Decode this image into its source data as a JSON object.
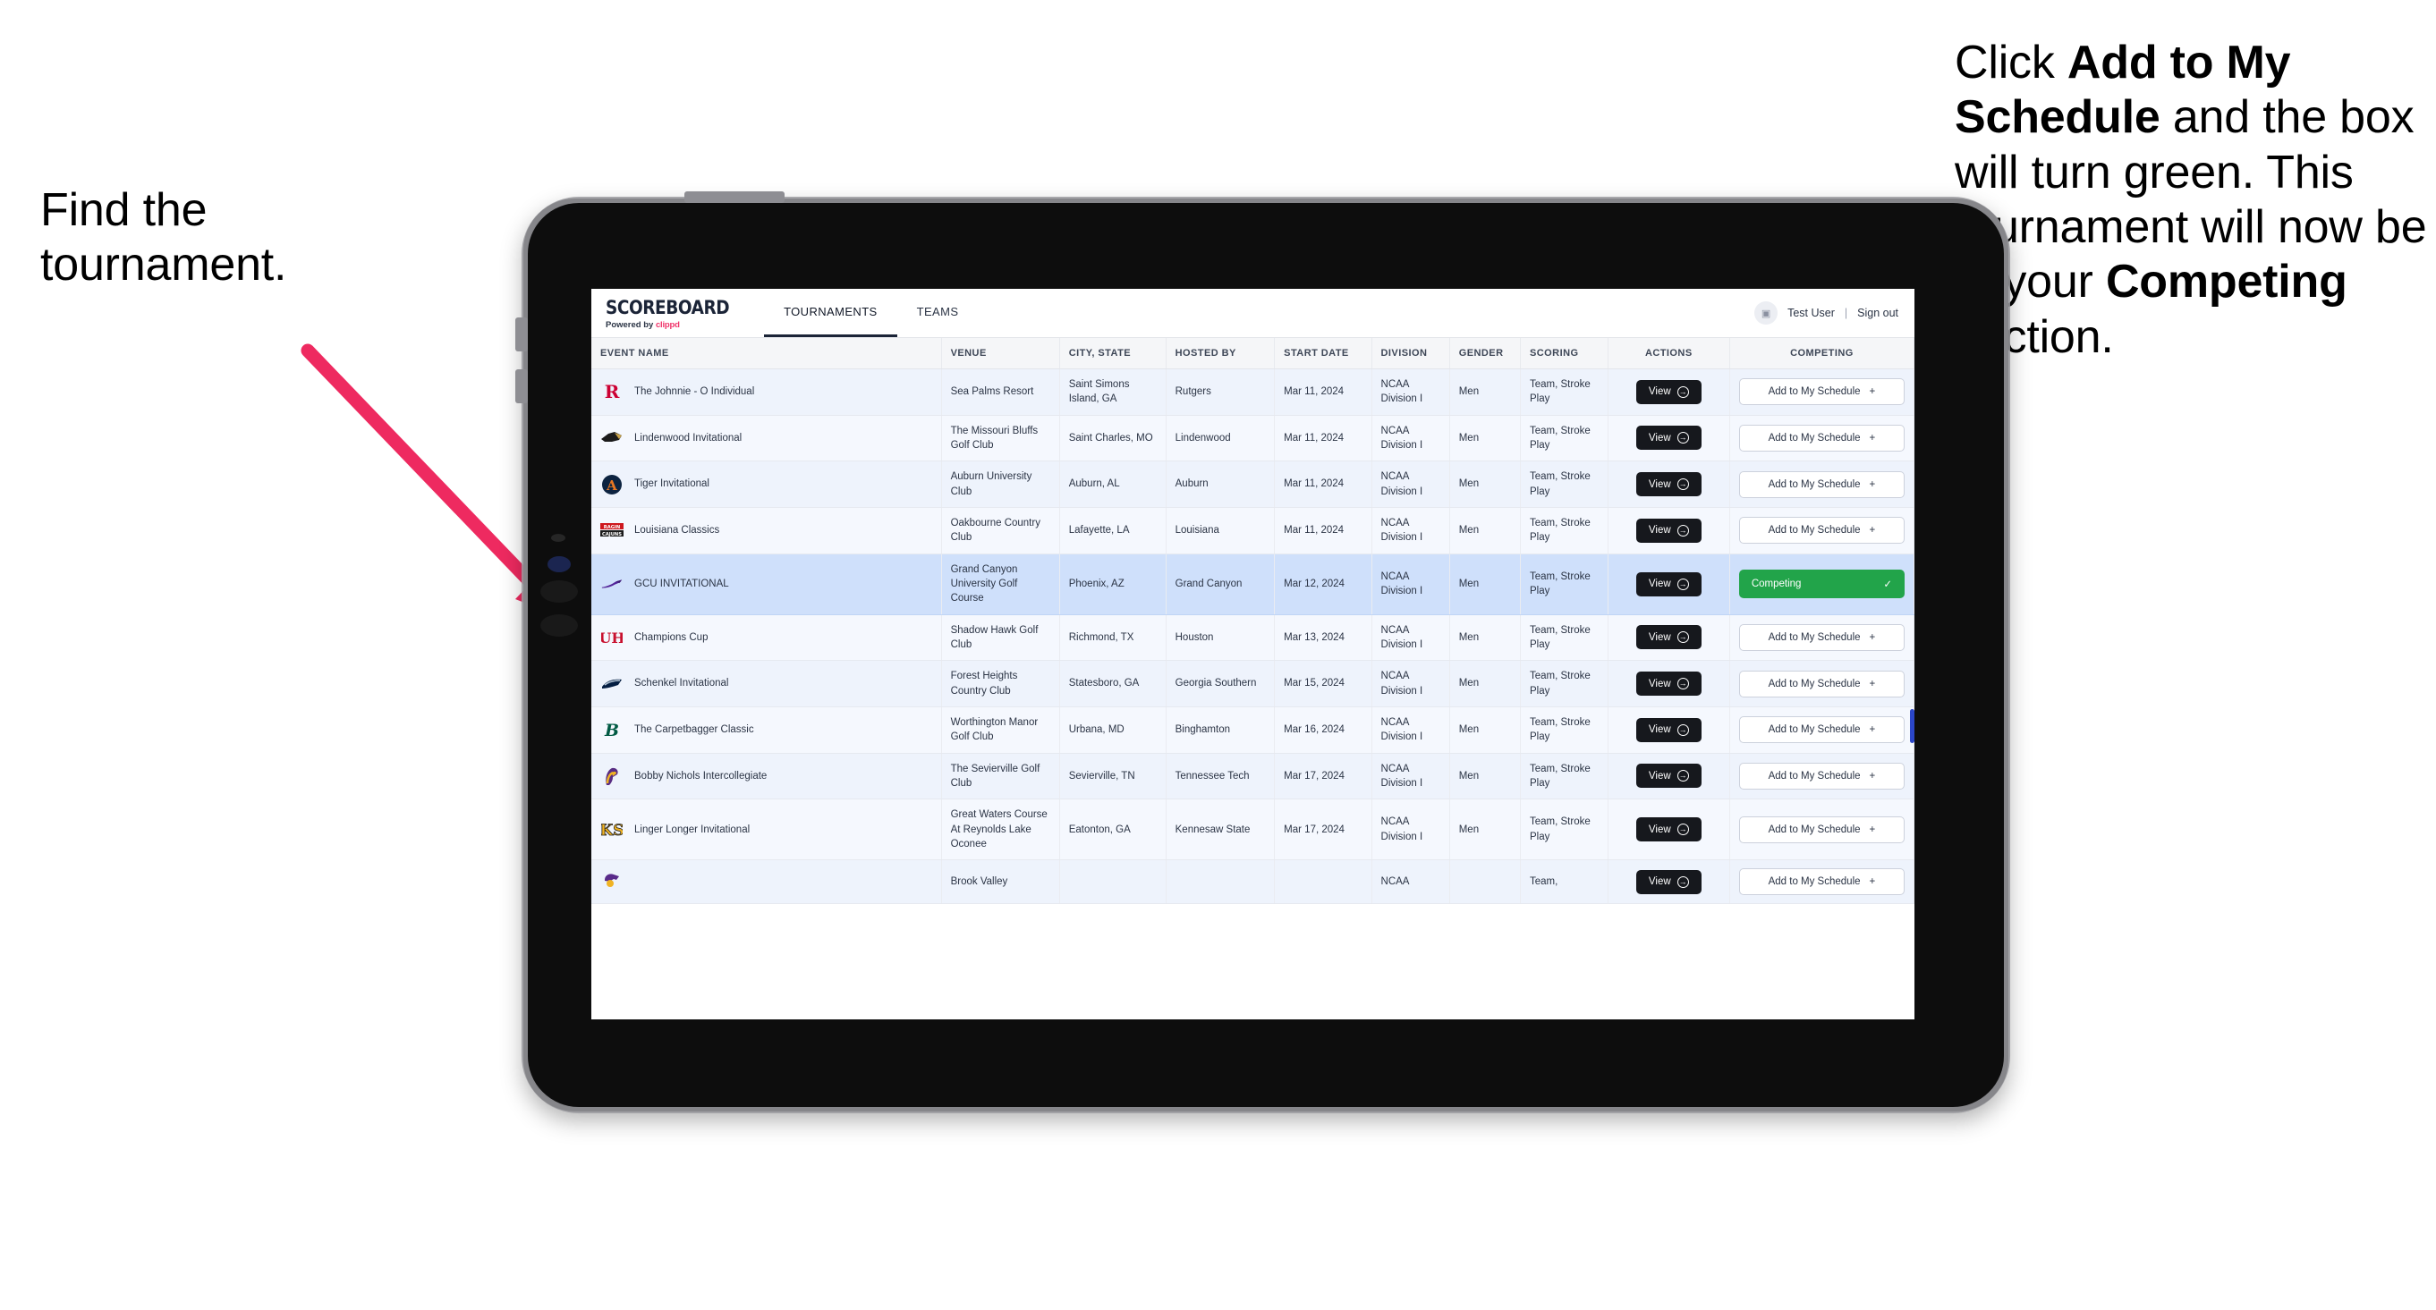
{
  "annotations": {
    "left": {
      "line1": "Find the",
      "line2": "tournament."
    },
    "right": {
      "seg1": "Click ",
      "bold1": "Add to My Schedule",
      "seg2": " and the box will turn green. This tournament will now be in your ",
      "bold2": "Competing",
      "seg3": " section."
    },
    "arrow_color": "#ee2a60"
  },
  "app": {
    "brand": {
      "title": "SCOREBOARD",
      "powered_prefix": "Powered by ",
      "powered_brand": "clippd"
    },
    "tabs": [
      {
        "label": "TOURNAMENTS",
        "active": true
      },
      {
        "label": "TEAMS",
        "active": false
      }
    ],
    "account": {
      "avatar_icon": "user-avatar-icon",
      "user": "Test User",
      "separator": "|",
      "signout": "Sign out"
    },
    "table": {
      "columns": [
        "EVENT NAME",
        "VENUE",
        "CITY, STATE",
        "HOSTED BY",
        "START DATE",
        "DIVISION",
        "GENDER",
        "SCORING",
        "ACTIONS",
        "COMPETING"
      ],
      "view_label": "View",
      "add_label": "Add to My Schedule",
      "add_icon": "plus-icon",
      "competing_label": "Competing",
      "competing_icon": "check-icon",
      "competing_color": "#22a44a",
      "rows": [
        {
          "logo": "rutgers-r-logo",
          "event": "The Johnnie - O Individual",
          "venue": "Sea Palms Resort",
          "city": "Saint Simons Island, GA",
          "hosted_by": "Rutgers",
          "start_date": "Mar 11, 2024",
          "division": "NCAA Division I",
          "gender": "Men",
          "scoring": "Team, Stroke Play",
          "competing": false
        },
        {
          "logo": "lindenwood-lion-logo",
          "event": "Lindenwood Invitational",
          "venue": "The Missouri Bluffs Golf Club",
          "city": "Saint Charles, MO",
          "hosted_by": "Lindenwood",
          "start_date": "Mar 11, 2024",
          "division": "NCAA Division I",
          "gender": "Men",
          "scoring": "Team, Stroke Play",
          "competing": false
        },
        {
          "logo": "auburn-au-logo",
          "event": "Tiger Invitational",
          "venue": "Auburn University Club",
          "city": "Auburn, AL",
          "hosted_by": "Auburn",
          "start_date": "Mar 11, 2024",
          "division": "NCAA Division I",
          "gender": "Men",
          "scoring": "Team, Stroke Play",
          "competing": false
        },
        {
          "logo": "louisiana-ragin-cajuns-logo",
          "event": "Louisiana Classics",
          "venue": "Oakbourne Country Club",
          "city": "Lafayette, LA",
          "hosted_by": "Louisiana",
          "start_date": "Mar 11, 2024",
          "division": "NCAA Division I",
          "gender": "Men",
          "scoring": "Team, Stroke Play",
          "competing": false
        },
        {
          "logo": "gcu-lope-logo",
          "event": "GCU INVITATIONAL",
          "venue": "Grand Canyon University Golf Course",
          "city": "Phoenix, AZ",
          "hosted_by": "Grand Canyon",
          "start_date": "Mar 12, 2024",
          "division": "NCAA Division I",
          "gender": "Men",
          "scoring": "Team, Stroke Play",
          "competing": true
        },
        {
          "logo": "houston-uh-logo",
          "event": "Champions Cup",
          "venue": "Shadow Hawk Golf Club",
          "city": "Richmond, TX",
          "hosted_by": "Houston",
          "start_date": "Mar 13, 2024",
          "division": "NCAA Division I",
          "gender": "Men",
          "scoring": "Team, Stroke Play",
          "competing": false
        },
        {
          "logo": "georgia-southern-eagle-logo",
          "event": "Schenkel Invitational",
          "venue": "Forest Heights Country Club",
          "city": "Statesboro, GA",
          "hosted_by": "Georgia Southern",
          "start_date": "Mar 15, 2024",
          "division": "NCAA Division I",
          "gender": "Men",
          "scoring": "Team, Stroke Play",
          "competing": false
        },
        {
          "logo": "binghamton-b-logo",
          "event": "The Carpetbagger Classic",
          "venue": "Worthington Manor Golf Club",
          "city": "Urbana, MD",
          "hosted_by": "Binghamton",
          "start_date": "Mar 16, 2024",
          "division": "NCAA Division I",
          "gender": "Men",
          "scoring": "Team, Stroke Play",
          "competing": false
        },
        {
          "logo": "tennessee-tech-eagle-logo",
          "event": "Bobby Nichols Intercollegiate",
          "venue": "The Sevierville Golf Club",
          "city": "Sevierville, TN",
          "hosted_by": "Tennessee Tech",
          "start_date": "Mar 17, 2024",
          "division": "NCAA Division I",
          "gender": "Men",
          "scoring": "Team, Stroke Play",
          "competing": false
        },
        {
          "logo": "kennesaw-state-ks-logo",
          "event": "Linger Longer Invitational",
          "venue": "Great Waters Course At Reynolds Lake Oconee",
          "city": "Eatonton, GA",
          "hosted_by": "Kennesaw State",
          "start_date": "Mar 17, 2024",
          "division": "NCAA Division I",
          "gender": "Men",
          "scoring": "Team, Stroke Play",
          "competing": false
        },
        {
          "logo": "ecu-pirate-logo",
          "event": "",
          "venue": "Brook Valley",
          "city": "",
          "hosted_by": "",
          "start_date": "",
          "division": "NCAA",
          "gender": "",
          "scoring": "Team,",
          "competing": false,
          "partial": true
        }
      ]
    }
  }
}
